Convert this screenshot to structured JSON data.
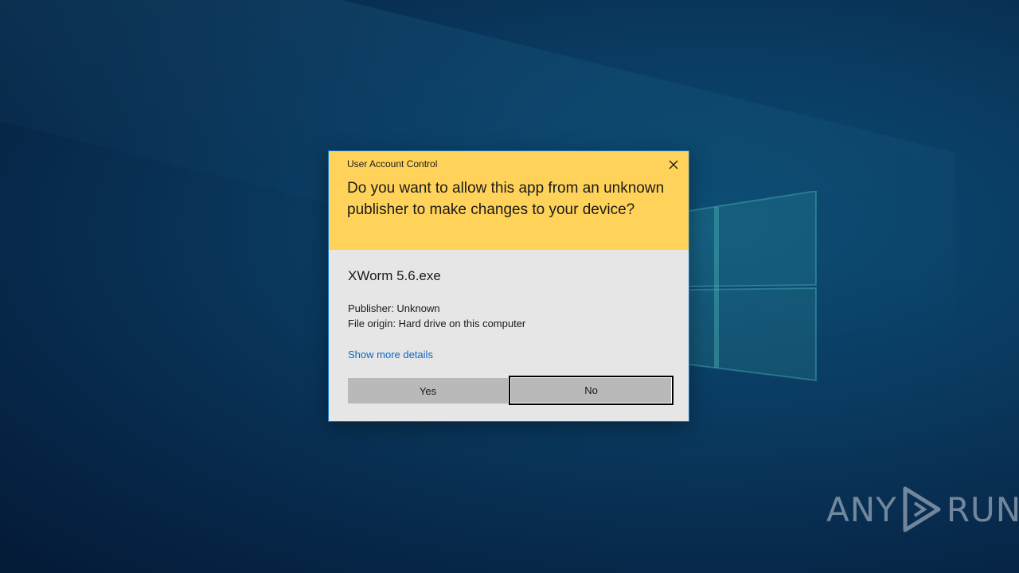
{
  "dialog": {
    "title": "User Account Control",
    "question": "Do you want to allow this app from an unknown publisher to make changes to your device?",
    "app_name": "XWorm 5.6.exe",
    "publisher": "Publisher: Unknown",
    "file_origin": "File origin: Hard drive on this computer",
    "details_link": "Show more details",
    "yes_label": "Yes",
    "no_label": "No",
    "close_icon": "close-icon"
  },
  "watermark": {
    "left_text": "ANY",
    "right_text": "RUN",
    "icon": "play-arrow-icon"
  },
  "colors": {
    "header_yellow": "#ffd35a",
    "body_gray": "#e6e6e6",
    "link_blue": "#0b69bf",
    "dialog_border": "#1979ca",
    "desktop_blue": "#0a3c62"
  }
}
